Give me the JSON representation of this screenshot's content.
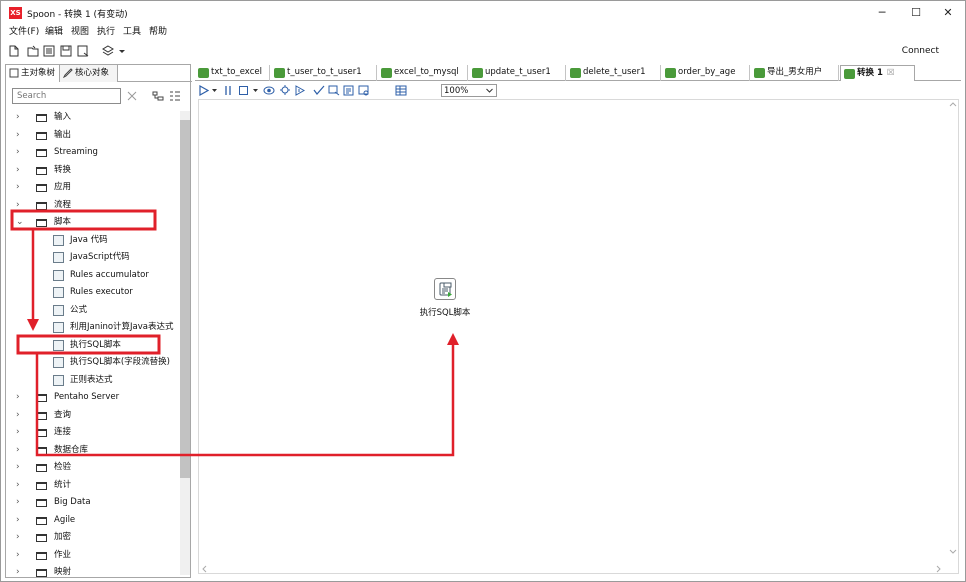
{
  "window": {
    "title": "Spoon - 转换 1 (有变动)",
    "icon_text": "XS",
    "minimize": "─",
    "maximize": "☐",
    "close": "✕"
  },
  "menu": [
    "文件(F)",
    "编辑",
    "视图",
    "执行",
    "工具",
    "帮助"
  ],
  "toolbar": {
    "connect": "Connect"
  },
  "left": {
    "tabs": [
      "主对象树",
      "核心对象"
    ],
    "search_placeholder": "Search",
    "tree": [
      {
        "label": "输入",
        "type": "folder",
        "expanded": false
      },
      {
        "label": "输出",
        "type": "folder",
        "expanded": false
      },
      {
        "label": "Streaming",
        "type": "folder",
        "expanded": false
      },
      {
        "label": "转换",
        "type": "folder",
        "expanded": false
      },
      {
        "label": "应用",
        "type": "folder",
        "expanded": false
      },
      {
        "label": "流程",
        "type": "folder",
        "expanded": false
      },
      {
        "label": "脚本",
        "type": "folder",
        "expanded": true
      },
      {
        "label": "Java 代码",
        "type": "step"
      },
      {
        "label": "JavaScript代码",
        "type": "step"
      },
      {
        "label": "Rules accumulator",
        "type": "step"
      },
      {
        "label": "Rules executor",
        "type": "step"
      },
      {
        "label": "公式",
        "type": "step"
      },
      {
        "label": "利用Janino计算Java表达式",
        "type": "step"
      },
      {
        "label": "执行SQL脚本",
        "type": "step"
      },
      {
        "label": "执行SQL脚本(字段流替换)",
        "type": "step"
      },
      {
        "label": "正则表达式",
        "type": "step"
      },
      {
        "label": "Pentaho Server",
        "type": "folder",
        "expanded": false
      },
      {
        "label": "查询",
        "type": "folder",
        "expanded": false
      },
      {
        "label": "连接",
        "type": "folder",
        "expanded": false
      },
      {
        "label": "数据仓库",
        "type": "folder",
        "expanded": false
      },
      {
        "label": "检验",
        "type": "folder",
        "expanded": false
      },
      {
        "label": "统计",
        "type": "folder",
        "expanded": false
      },
      {
        "label": "Big Data",
        "type": "folder",
        "expanded": false
      },
      {
        "label": "Agile",
        "type": "folder",
        "expanded": false
      },
      {
        "label": "加密",
        "type": "folder",
        "expanded": false
      },
      {
        "label": "作业",
        "type": "folder",
        "expanded": false
      },
      {
        "label": "映射",
        "type": "folder",
        "expanded": false
      }
    ]
  },
  "tabs": [
    {
      "label": "txt_to_excel"
    },
    {
      "label": "t_user_to_t_user1"
    },
    {
      "label": "excel_to_mysql"
    },
    {
      "label": "update_t_user1"
    },
    {
      "label": "delete_t_user1"
    },
    {
      "label": "order_by_age"
    },
    {
      "label": "导出_男女用户"
    },
    {
      "label": "转换 1",
      "active": true,
      "close": "☒"
    }
  ],
  "canvas_toolbar": {
    "zoom": "100%"
  },
  "canvas": {
    "step_label": "执行SQL脚本"
  },
  "colors": {
    "highlight": "#e0202a",
    "accent": "#4a9a3a"
  }
}
